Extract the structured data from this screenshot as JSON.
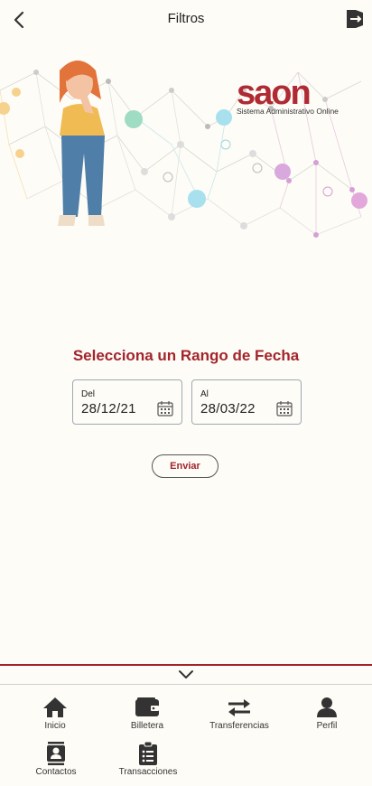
{
  "header": {
    "title": "Filtros",
    "back_icon": "chevron-left-icon",
    "exit_icon": "logout-icon"
  },
  "banner": {
    "brand_name": "saon",
    "brand_tagline": "Sistema Administrativo Online",
    "brand_color": "#b02a34"
  },
  "date_range": {
    "title": "Selecciona un Rango de Fecha",
    "from": {
      "label": "Del",
      "value": "28/12/21"
    },
    "to": {
      "label": "Al",
      "value": "28/03/22"
    },
    "submit_label": "Enviar"
  },
  "nav": {
    "items": [
      {
        "label": "Inicio",
        "icon": "home-icon"
      },
      {
        "label": "Billetera",
        "icon": "wallet-icon"
      },
      {
        "label": "Transferencias",
        "icon": "transfer-icon"
      },
      {
        "label": "Perfil",
        "icon": "user-icon"
      },
      {
        "label": "Contactos",
        "icon": "contacts-icon"
      },
      {
        "label": "Transacciones",
        "icon": "clipboard-list-icon"
      }
    ]
  },
  "colors": {
    "accent": "#a3242c",
    "background": "#fdfcf6"
  }
}
